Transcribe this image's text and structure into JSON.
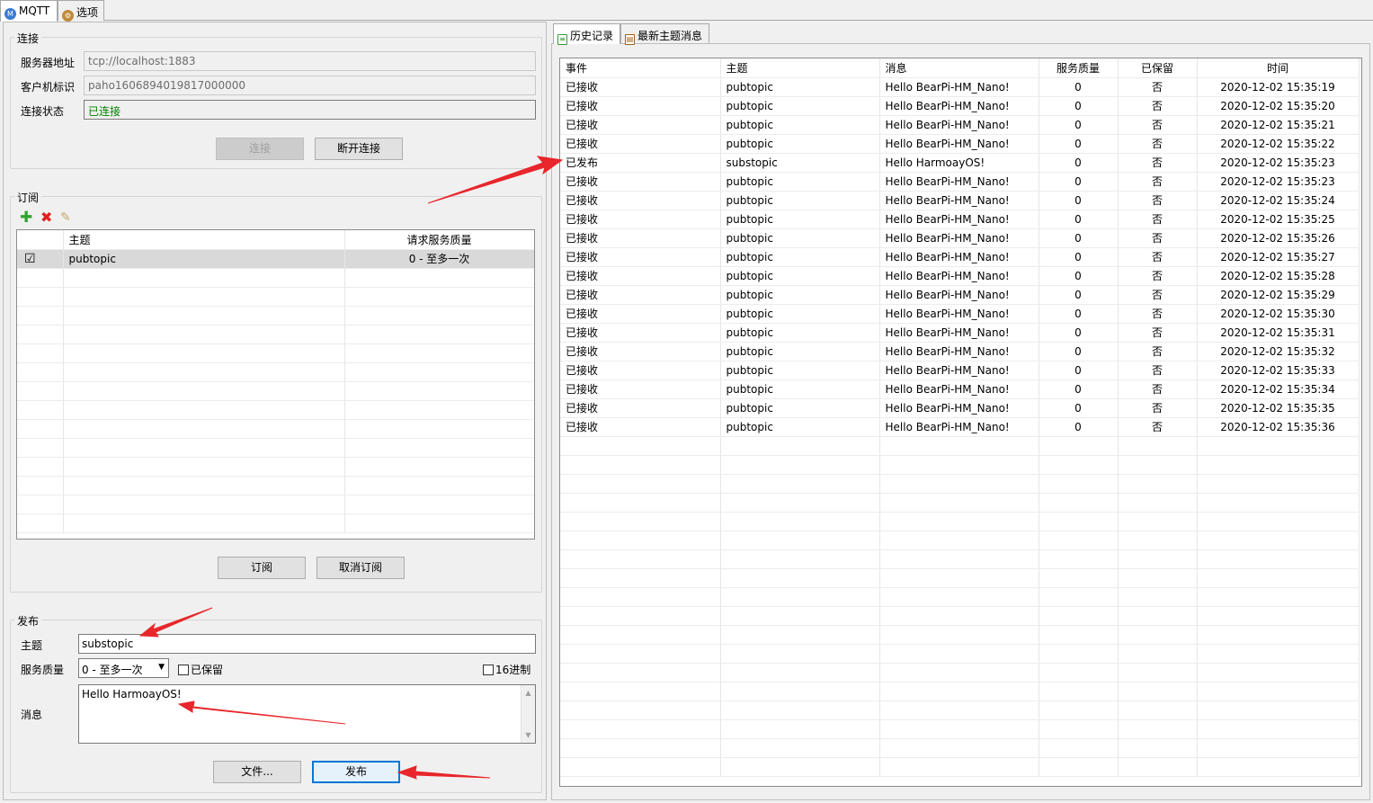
{
  "top_tabs": [
    {
      "label": "MQTT"
    },
    {
      "label": "选项"
    }
  ],
  "connection": {
    "group_title": "连接",
    "server_label": "服务器地址",
    "server_value": "tcp://localhost:1883",
    "client_label": "客户机标识",
    "client_value": "paho1606894019817000000",
    "status_label": "连接状态",
    "status_value": "已连接",
    "connect_btn": "连接",
    "disconnect_btn": "断开连接"
  },
  "subscribe": {
    "group_title": "订阅",
    "col_topic": "主题",
    "col_qos": "请求服务质量",
    "rows": [
      {
        "topic": "pubtopic",
        "qos": "0 - 至多一次",
        "checked": "☑"
      }
    ],
    "subscribe_btn": "订阅",
    "unsubscribe_btn": "取消订阅"
  },
  "publish": {
    "group_title": "发布",
    "topic_label": "主题",
    "topic_value": "substopic",
    "qos_label": "服务质量",
    "qos_value": "0 - 至多一次",
    "retain_label": "已保留",
    "hex_label": "16进制",
    "message_label": "消息",
    "message_value": "Hello HarmoayOS!",
    "file_btn": "文件...",
    "publish_btn": "发布"
  },
  "right_tabs": [
    {
      "label": "历史记录"
    },
    {
      "label": "最新主题消息"
    }
  ],
  "history": {
    "headers": [
      "事件",
      "主题",
      "消息",
      "服务质量",
      "已保留",
      "时间"
    ],
    "rows": [
      [
        "已接收",
        "pubtopic",
        "Hello BearPi-HM_Nano!",
        "0",
        "否",
        "2020-12-02 15:35:19"
      ],
      [
        "已接收",
        "pubtopic",
        "Hello BearPi-HM_Nano!",
        "0",
        "否",
        "2020-12-02 15:35:20"
      ],
      [
        "已接收",
        "pubtopic",
        "Hello BearPi-HM_Nano!",
        "0",
        "否",
        "2020-12-02 15:35:21"
      ],
      [
        "已接收",
        "pubtopic",
        "Hello BearPi-HM_Nano!",
        "0",
        "否",
        "2020-12-02 15:35:22"
      ],
      [
        "已发布",
        "substopic",
        "Hello HarmoayOS!",
        "0",
        "否",
        "2020-12-02 15:35:23"
      ],
      [
        "已接收",
        "pubtopic",
        "Hello BearPi-HM_Nano!",
        "0",
        "否",
        "2020-12-02 15:35:23"
      ],
      [
        "已接收",
        "pubtopic",
        "Hello BearPi-HM_Nano!",
        "0",
        "否",
        "2020-12-02 15:35:24"
      ],
      [
        "已接收",
        "pubtopic",
        "Hello BearPi-HM_Nano!",
        "0",
        "否",
        "2020-12-02 15:35:25"
      ],
      [
        "已接收",
        "pubtopic",
        "Hello BearPi-HM_Nano!",
        "0",
        "否",
        "2020-12-02 15:35:26"
      ],
      [
        "已接收",
        "pubtopic",
        "Hello BearPi-HM_Nano!",
        "0",
        "否",
        "2020-12-02 15:35:27"
      ],
      [
        "已接收",
        "pubtopic",
        "Hello BearPi-HM_Nano!",
        "0",
        "否",
        "2020-12-02 15:35:28"
      ],
      [
        "已接收",
        "pubtopic",
        "Hello BearPi-HM_Nano!",
        "0",
        "否",
        "2020-12-02 15:35:29"
      ],
      [
        "已接收",
        "pubtopic",
        "Hello BearPi-HM_Nano!",
        "0",
        "否",
        "2020-12-02 15:35:30"
      ],
      [
        "已接收",
        "pubtopic",
        "Hello BearPi-HM_Nano!",
        "0",
        "否",
        "2020-12-02 15:35:31"
      ],
      [
        "已接收",
        "pubtopic",
        "Hello BearPi-HM_Nano!",
        "0",
        "否",
        "2020-12-02 15:35:32"
      ],
      [
        "已接收",
        "pubtopic",
        "Hello BearPi-HM_Nano!",
        "0",
        "否",
        "2020-12-02 15:35:33"
      ],
      [
        "已接收",
        "pubtopic",
        "Hello BearPi-HM_Nano!",
        "0",
        "否",
        "2020-12-02 15:35:34"
      ],
      [
        "已接收",
        "pubtopic",
        "Hello BearPi-HM_Nano!",
        "0",
        "否",
        "2020-12-02 15:35:35"
      ],
      [
        "已接收",
        "pubtopic",
        "Hello BearPi-HM_Nano!",
        "0",
        "否",
        "2020-12-02 15:35:36"
      ]
    ]
  },
  "colors": {
    "status_green": "#008000",
    "arrow_red": "#e8262b"
  }
}
